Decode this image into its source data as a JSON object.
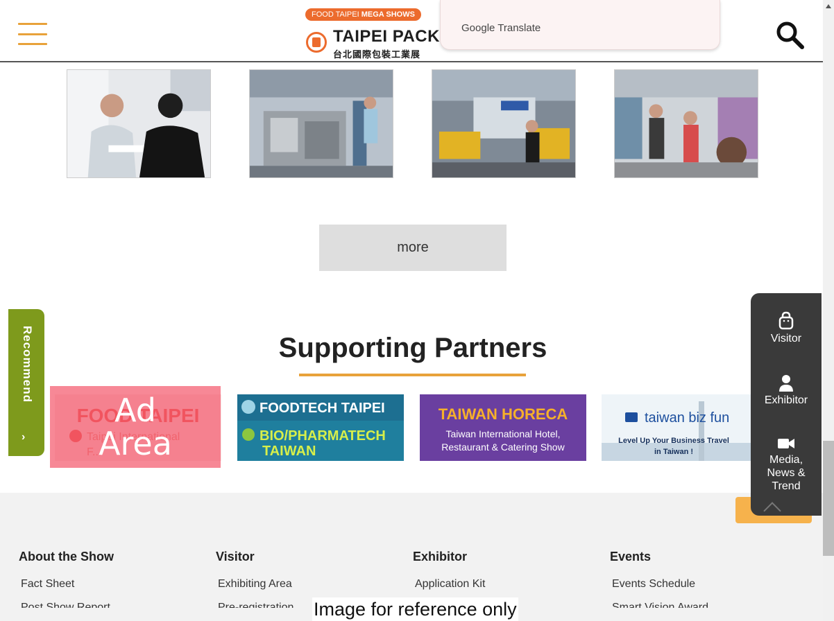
{
  "header": {
    "badge_prefix": "FOOD TAIPEI",
    "badge_bold": "MEGA SHOWS",
    "logo_title": "TAIPEI PACK",
    "logo_subtitle": "台北國際包裝工業展",
    "translate_label": "Google Translate"
  },
  "more_label": "more",
  "section_title": "Supporting Partners",
  "partners": [
    {
      "line1": "FOOD TAIPEI",
      "line2": "Taipei International",
      "line3": "F..."
    },
    {
      "line1": "FOODTECH TAIPEI",
      "line2": "BIO/PHARMATECH",
      "line3": "TAIWAN"
    },
    {
      "line1": "TAIWAN HORECA",
      "line2": "Taiwan International Hotel,",
      "line3": "Restaurant & Catering Show"
    },
    {
      "line1": "taiwan biz fun",
      "line2": "Level Up Your Business Travel",
      "line3": "in Taiwan !"
    }
  ],
  "ad_overlay": "Ad Area",
  "recommend_label": "Recommend",
  "recommend_arrow": "›",
  "float_menu": {
    "visitor": "Visitor",
    "exhibitor": "Exhibitor",
    "media": "Media, News & Trend"
  },
  "footer": {
    "columns": [
      {
        "heading": "About the Show",
        "links": [
          "Fact Sheet"
        ],
        "cut": "Post Show Report"
      },
      {
        "heading": "Visitor",
        "links": [
          "Exhibiting Area"
        ],
        "cut": "Pre-registration"
      },
      {
        "heading": "Exhibitor",
        "links": [
          "Application Kit"
        ],
        "cut": ""
      },
      {
        "heading": "Events",
        "links": [
          "Events Schedule"
        ],
        "cut": "Smart Vision Award"
      }
    ]
  },
  "reference_note": "Image for reference only",
  "colors": {
    "accent": "#e8a23a",
    "orange": "#ec6b2d",
    "recommend": "#7e9a1c",
    "menu_bg": "#3a3a3a"
  }
}
